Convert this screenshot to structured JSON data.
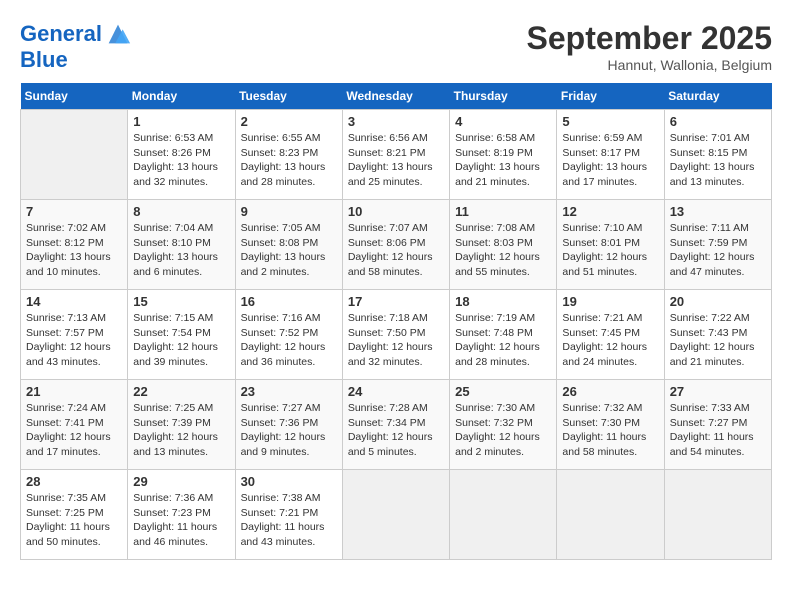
{
  "header": {
    "logo_line1": "General",
    "logo_line2": "Blue",
    "month": "September 2025",
    "location": "Hannut, Wallonia, Belgium"
  },
  "weekdays": [
    "Sunday",
    "Monday",
    "Tuesday",
    "Wednesday",
    "Thursday",
    "Friday",
    "Saturday"
  ],
  "weeks": [
    [
      {
        "day": "",
        "info": ""
      },
      {
        "day": "1",
        "info": "Sunrise: 6:53 AM\nSunset: 8:26 PM\nDaylight: 13 hours\nand 32 minutes."
      },
      {
        "day": "2",
        "info": "Sunrise: 6:55 AM\nSunset: 8:23 PM\nDaylight: 13 hours\nand 28 minutes."
      },
      {
        "day": "3",
        "info": "Sunrise: 6:56 AM\nSunset: 8:21 PM\nDaylight: 13 hours\nand 25 minutes."
      },
      {
        "day": "4",
        "info": "Sunrise: 6:58 AM\nSunset: 8:19 PM\nDaylight: 13 hours\nand 21 minutes."
      },
      {
        "day": "5",
        "info": "Sunrise: 6:59 AM\nSunset: 8:17 PM\nDaylight: 13 hours\nand 17 minutes."
      },
      {
        "day": "6",
        "info": "Sunrise: 7:01 AM\nSunset: 8:15 PM\nDaylight: 13 hours\nand 13 minutes."
      }
    ],
    [
      {
        "day": "7",
        "info": "Sunrise: 7:02 AM\nSunset: 8:12 PM\nDaylight: 13 hours\nand 10 minutes."
      },
      {
        "day": "8",
        "info": "Sunrise: 7:04 AM\nSunset: 8:10 PM\nDaylight: 13 hours\nand 6 minutes."
      },
      {
        "day": "9",
        "info": "Sunrise: 7:05 AM\nSunset: 8:08 PM\nDaylight: 13 hours\nand 2 minutes."
      },
      {
        "day": "10",
        "info": "Sunrise: 7:07 AM\nSunset: 8:06 PM\nDaylight: 12 hours\nand 58 minutes."
      },
      {
        "day": "11",
        "info": "Sunrise: 7:08 AM\nSunset: 8:03 PM\nDaylight: 12 hours\nand 55 minutes."
      },
      {
        "day": "12",
        "info": "Sunrise: 7:10 AM\nSunset: 8:01 PM\nDaylight: 12 hours\nand 51 minutes."
      },
      {
        "day": "13",
        "info": "Sunrise: 7:11 AM\nSunset: 7:59 PM\nDaylight: 12 hours\nand 47 minutes."
      }
    ],
    [
      {
        "day": "14",
        "info": "Sunrise: 7:13 AM\nSunset: 7:57 PM\nDaylight: 12 hours\nand 43 minutes."
      },
      {
        "day": "15",
        "info": "Sunrise: 7:15 AM\nSunset: 7:54 PM\nDaylight: 12 hours\nand 39 minutes."
      },
      {
        "day": "16",
        "info": "Sunrise: 7:16 AM\nSunset: 7:52 PM\nDaylight: 12 hours\nand 36 minutes."
      },
      {
        "day": "17",
        "info": "Sunrise: 7:18 AM\nSunset: 7:50 PM\nDaylight: 12 hours\nand 32 minutes."
      },
      {
        "day": "18",
        "info": "Sunrise: 7:19 AM\nSunset: 7:48 PM\nDaylight: 12 hours\nand 28 minutes."
      },
      {
        "day": "19",
        "info": "Sunrise: 7:21 AM\nSunset: 7:45 PM\nDaylight: 12 hours\nand 24 minutes."
      },
      {
        "day": "20",
        "info": "Sunrise: 7:22 AM\nSunset: 7:43 PM\nDaylight: 12 hours\nand 21 minutes."
      }
    ],
    [
      {
        "day": "21",
        "info": "Sunrise: 7:24 AM\nSunset: 7:41 PM\nDaylight: 12 hours\nand 17 minutes."
      },
      {
        "day": "22",
        "info": "Sunrise: 7:25 AM\nSunset: 7:39 PM\nDaylight: 12 hours\nand 13 minutes."
      },
      {
        "day": "23",
        "info": "Sunrise: 7:27 AM\nSunset: 7:36 PM\nDaylight: 12 hours\nand 9 minutes."
      },
      {
        "day": "24",
        "info": "Sunrise: 7:28 AM\nSunset: 7:34 PM\nDaylight: 12 hours\nand 5 minutes."
      },
      {
        "day": "25",
        "info": "Sunrise: 7:30 AM\nSunset: 7:32 PM\nDaylight: 12 hours\nand 2 minutes."
      },
      {
        "day": "26",
        "info": "Sunrise: 7:32 AM\nSunset: 7:30 PM\nDaylight: 11 hours\nand 58 minutes."
      },
      {
        "day": "27",
        "info": "Sunrise: 7:33 AM\nSunset: 7:27 PM\nDaylight: 11 hours\nand 54 minutes."
      }
    ],
    [
      {
        "day": "28",
        "info": "Sunrise: 7:35 AM\nSunset: 7:25 PM\nDaylight: 11 hours\nand 50 minutes."
      },
      {
        "day": "29",
        "info": "Sunrise: 7:36 AM\nSunset: 7:23 PM\nDaylight: 11 hours\nand 46 minutes."
      },
      {
        "day": "30",
        "info": "Sunrise: 7:38 AM\nSunset: 7:21 PM\nDaylight: 11 hours\nand 43 minutes."
      },
      {
        "day": "",
        "info": ""
      },
      {
        "day": "",
        "info": ""
      },
      {
        "day": "",
        "info": ""
      },
      {
        "day": "",
        "info": ""
      }
    ]
  ]
}
